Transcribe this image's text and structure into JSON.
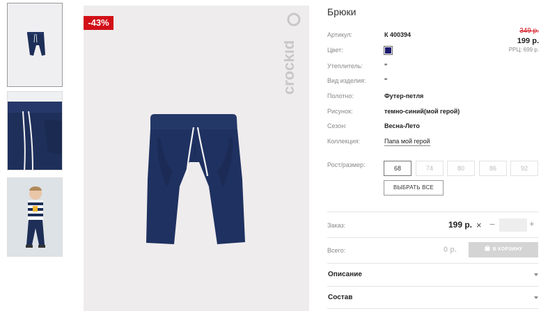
{
  "gallery": {
    "discount_badge": "-43%",
    "brand_logo": "crockid"
  },
  "product": {
    "title": "Брюки",
    "attributes": [
      {
        "label": "Артикул:",
        "value": "К 400394"
      },
      {
        "label": "Цвет:",
        "value": "",
        "color": "#1b1a6e"
      },
      {
        "label": "Утеплитель:",
        "value": "\""
      },
      {
        "label": "Вид изделия:",
        "value": "\""
      },
      {
        "label": "Полотно:",
        "value": "Футер-петля"
      },
      {
        "label": "Рисунок:",
        "value": "темно-синий(мой герой)"
      },
      {
        "label": "Сезон:",
        "value": "Весна-Лето"
      },
      {
        "label": "Коллекция:",
        "value": "Папа мой герой"
      }
    ],
    "price_old": "349 р.",
    "price_new": "199 р.",
    "price_rrp": "РРЦ: 699 р."
  },
  "sizes": {
    "label": "Рост/размер:",
    "options": [
      "68",
      "74",
      "80",
      "86",
      "92"
    ],
    "selected": "68",
    "select_all_label": "ВЫБРАТЬ ВСЕ"
  },
  "order": {
    "label": "Заказ:",
    "unit_price": "199 р.",
    "times": "×",
    "minus": "−",
    "plus": "+",
    "quantity": ""
  },
  "total": {
    "label": "Всего:",
    "value": "0 р.",
    "cart_button": "В КОРЗИНУ"
  },
  "accordions": [
    "Описание",
    "Состав"
  ]
}
